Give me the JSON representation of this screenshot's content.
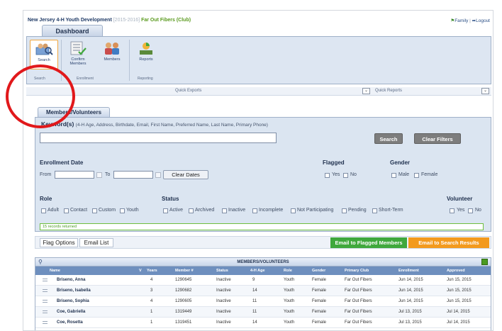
{
  "header": {
    "org_name": "New Jersey 4-H Youth Development",
    "year_range": "[2015-2016]",
    "club": "Far Out Fibers (Club)",
    "family_link": "Family",
    "logout_link": "Logout"
  },
  "tabs": {
    "dashboard": "Dashboard"
  },
  "ribbon": {
    "tools": [
      {
        "label": "Search",
        "icon": "search-people-icon"
      },
      {
        "label": "Confirm Members",
        "icon": "confirm-list-icon"
      },
      {
        "label": "Members",
        "icon": "members-icon"
      },
      {
        "label": "Reports",
        "icon": "reports-icon"
      }
    ],
    "groups": [
      "Search",
      "Enrollment",
      "Reporting"
    ]
  },
  "quickbar": {
    "exports": "Quick Exports",
    "reports": "Quick Reports"
  },
  "members_tab": "Members/Volunteers",
  "filters": {
    "keyword_label": "Keyword(s)",
    "keyword_hint": "(4-H Age, Address, Birthdate, Email, First Name, Preferred Name, Last Name, Primary Phone)",
    "keyword_value": "",
    "search_button": "Search",
    "clear_filters_button": "Clear Filters",
    "enrollment_date": "Enrollment Date",
    "from_label": "From",
    "to_label": "To",
    "clear_dates": "Clear Dates",
    "flagged": "Flagged",
    "flag_yes": "Yes",
    "flag_no": "No",
    "gender": "Gender",
    "gender_male": "Male",
    "gender_female": "Female",
    "role": "Role",
    "roles": [
      "Adult",
      "Contact",
      "Custom",
      "Youth"
    ],
    "status": "Status",
    "statuses": [
      "Active",
      "Archived",
      "Inactive",
      "Incomplete",
      "Not Participating",
      "Pending",
      "Short-Term"
    ],
    "volunteer": "Volunteer",
    "vol_yes": "Yes",
    "vol_no": "No",
    "records_returned": "15 records returned"
  },
  "actions": {
    "flag_options": "Flag Options",
    "email_list": "Email List",
    "email_flagged": "Email to Flagged Members",
    "email_search": "Email to Search Results"
  },
  "grid": {
    "title": "MEMBERS/VOLUNTEERS",
    "columns": [
      "Name",
      "V",
      "Years",
      "Member #",
      "Status",
      "4-H Age",
      "Role",
      "Gender",
      "Primary Club",
      "Enrollment",
      "Approved"
    ],
    "rows": [
      [
        "Briseno, Anna",
        "",
        "4",
        "1290645",
        "Inactive",
        "9",
        "Youth",
        "Female",
        "Far Out Fibers",
        "Jun 14, 2015",
        "Jun 15, 2015"
      ],
      [
        "Briseno, Isabella",
        "",
        "3",
        "1290682",
        "Inactive",
        "14",
        "Youth",
        "Female",
        "Far Out Fibers",
        "Jun 14, 2015",
        "Jun 15, 2015"
      ],
      [
        "Briseno, Sophia",
        "",
        "4",
        "1290605",
        "Inactive",
        "11",
        "Youth",
        "Female",
        "Far Out Fibers",
        "Jun 14, 2015",
        "Jun 15, 2015"
      ],
      [
        "Coe, Gabriella",
        "",
        "1",
        "1319449",
        "Inactive",
        "11",
        "Youth",
        "Female",
        "Far Out Fibers",
        "Jul 13, 2015",
        "Jul 14, 2015"
      ],
      [
        "Coe, Rosetta",
        "",
        "1",
        "1319451",
        "Inactive",
        "14",
        "Youth",
        "Female",
        "Far Out Fibers",
        "Jul 13, 2015",
        "Jul 14, 2015"
      ]
    ]
  }
}
